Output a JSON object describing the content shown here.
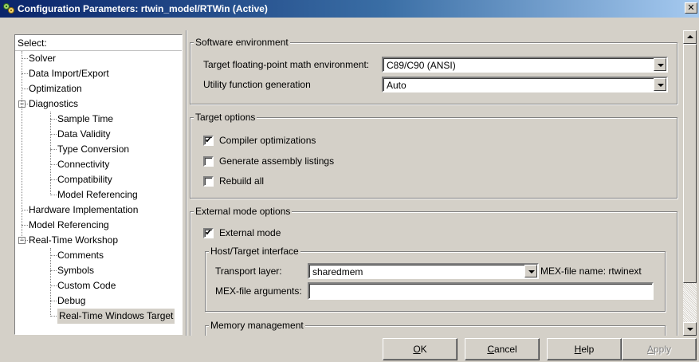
{
  "window": {
    "title": "Configuration Parameters: rtwin_model/RTWin (Active)",
    "close_symbol": "✕"
  },
  "tree": {
    "header": "Select:",
    "items": [
      {
        "label": "Solver",
        "level": 1
      },
      {
        "label": "Data Import/Export",
        "level": 1
      },
      {
        "label": "Optimization",
        "level": 1
      },
      {
        "label": "Diagnostics",
        "level": 1,
        "expander": "−"
      },
      {
        "label": "Sample Time",
        "level": 2
      },
      {
        "label": "Data Validity",
        "level": 2
      },
      {
        "label": "Type Conversion",
        "level": 2
      },
      {
        "label": "Connectivity",
        "level": 2
      },
      {
        "label": "Compatibility",
        "level": 2
      },
      {
        "label": "Model Referencing",
        "level": 2
      },
      {
        "label": "Hardware Implementation",
        "level": 1
      },
      {
        "label": "Model Referencing",
        "level": 1
      },
      {
        "label": "Real-Time Workshop",
        "level": 1,
        "expander": "−"
      },
      {
        "label": "Comments",
        "level": 2
      },
      {
        "label": "Symbols",
        "level": 2
      },
      {
        "label": "Custom Code",
        "level": 2
      },
      {
        "label": "Debug",
        "level": 2
      },
      {
        "label": "Real-Time Windows Target",
        "level": 2,
        "selected": true
      }
    ]
  },
  "software_env": {
    "title": "Software environment",
    "math_label": "Target floating-point math environment:",
    "math_value": "C89/C90 (ANSI)",
    "utility_label": "Utility function generation",
    "utility_value": "Auto"
  },
  "target_options": {
    "title": "Target options",
    "compiler_opt": {
      "label": "Compiler optimizations",
      "checked": true
    },
    "assembly": {
      "label": "Generate assembly listings",
      "checked": false
    },
    "rebuild": {
      "label": "Rebuild all",
      "checked": false
    }
  },
  "external_mode": {
    "title": "External mode options",
    "external": {
      "label": "External mode",
      "checked": true
    },
    "host_target": {
      "title": "Host/Target interface",
      "transport_label": "Transport layer:",
      "transport_value": "sharedmem",
      "mex_name": "MEX-file name: rtwinext",
      "mex_args_label": "MEX-file arguments:",
      "mex_args_value": ""
    },
    "memory": {
      "title": "Memory management"
    }
  },
  "buttons": {
    "ok": {
      "mnemonic": "O",
      "rest": "K"
    },
    "cancel": {
      "mnemonic": "C",
      "rest": "ancel"
    },
    "help": {
      "mnemonic": "H",
      "rest": "elp"
    },
    "apply": {
      "mnemonic": "A",
      "rest": "pply"
    }
  },
  "check_mark": "✔"
}
